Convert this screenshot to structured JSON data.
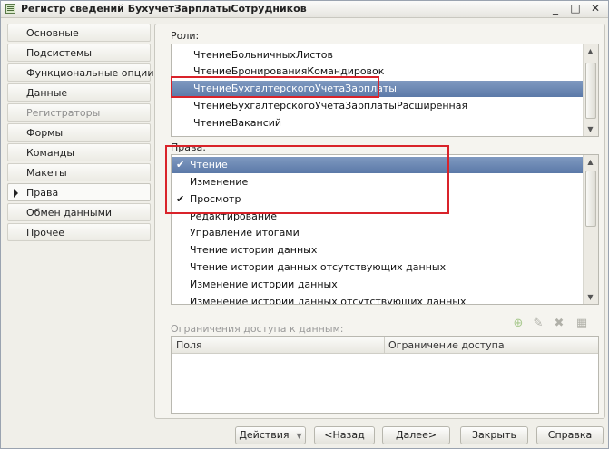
{
  "window": {
    "title": "Регистр сведений БухучетЗарплатыСотрудников",
    "icon": "register-icon",
    "controls": {
      "minimize": "_",
      "maximize": "□",
      "close": "✕"
    }
  },
  "sidebar": {
    "items": [
      {
        "label": "Основные",
        "state": "normal"
      },
      {
        "label": "Подсистемы",
        "state": "normal"
      },
      {
        "label": "Функциональные опции",
        "state": "normal"
      },
      {
        "label": "Данные",
        "state": "normal"
      },
      {
        "label": "Регистраторы",
        "state": "disabled"
      },
      {
        "label": "Формы",
        "state": "normal"
      },
      {
        "label": "Команды",
        "state": "normal"
      },
      {
        "label": "Макеты",
        "state": "normal"
      },
      {
        "label": "Права",
        "state": "active"
      },
      {
        "label": "Обмен данными",
        "state": "normal"
      },
      {
        "label": "Прочее",
        "state": "normal"
      }
    ]
  },
  "roles": {
    "label": "Роли:",
    "items": [
      "ЧтениеБольничныхЛистов",
      "ЧтениеБронированияКомандировок",
      "ЧтениеБухгалтерскогоУчетаЗарплаты",
      "ЧтениеБухгалтерскогоУчетаЗарплатыРасширенная",
      "ЧтениеВакансий"
    ],
    "selected_index": 2
  },
  "rights": {
    "label": "Права:",
    "items": [
      {
        "label": "Чтение",
        "checked": true
      },
      {
        "label": "Изменение",
        "checked": false
      },
      {
        "label": "Просмотр",
        "checked": true
      },
      {
        "label": "Редактирование",
        "checked": false
      },
      {
        "label": "Управление итогами",
        "checked": false
      },
      {
        "label": "Чтение истории данных",
        "checked": false
      },
      {
        "label": "Чтение истории данных отсутствующих данных",
        "checked": false
      },
      {
        "label": "Изменение истории данных",
        "checked": false
      },
      {
        "label": "Изменение истории данных отсутствующих данных",
        "checked": false
      }
    ],
    "selected_index": 0,
    "check_glyph": "✔"
  },
  "restrictions": {
    "label": "Ограничения доступа к данным:",
    "columns": [
      "Поля",
      "Ограничение доступа"
    ],
    "toolbar_icons": [
      "add-icon",
      "edit-icon",
      "delete-icon",
      "templates-icon"
    ]
  },
  "buttons": {
    "actions": "Действия",
    "back": "<Назад",
    "next": "Далее>",
    "close": "Закрыть",
    "help": "Справка"
  },
  "colors": {
    "selection": "#5b79a8",
    "highlight_box": "#d9232a"
  }
}
